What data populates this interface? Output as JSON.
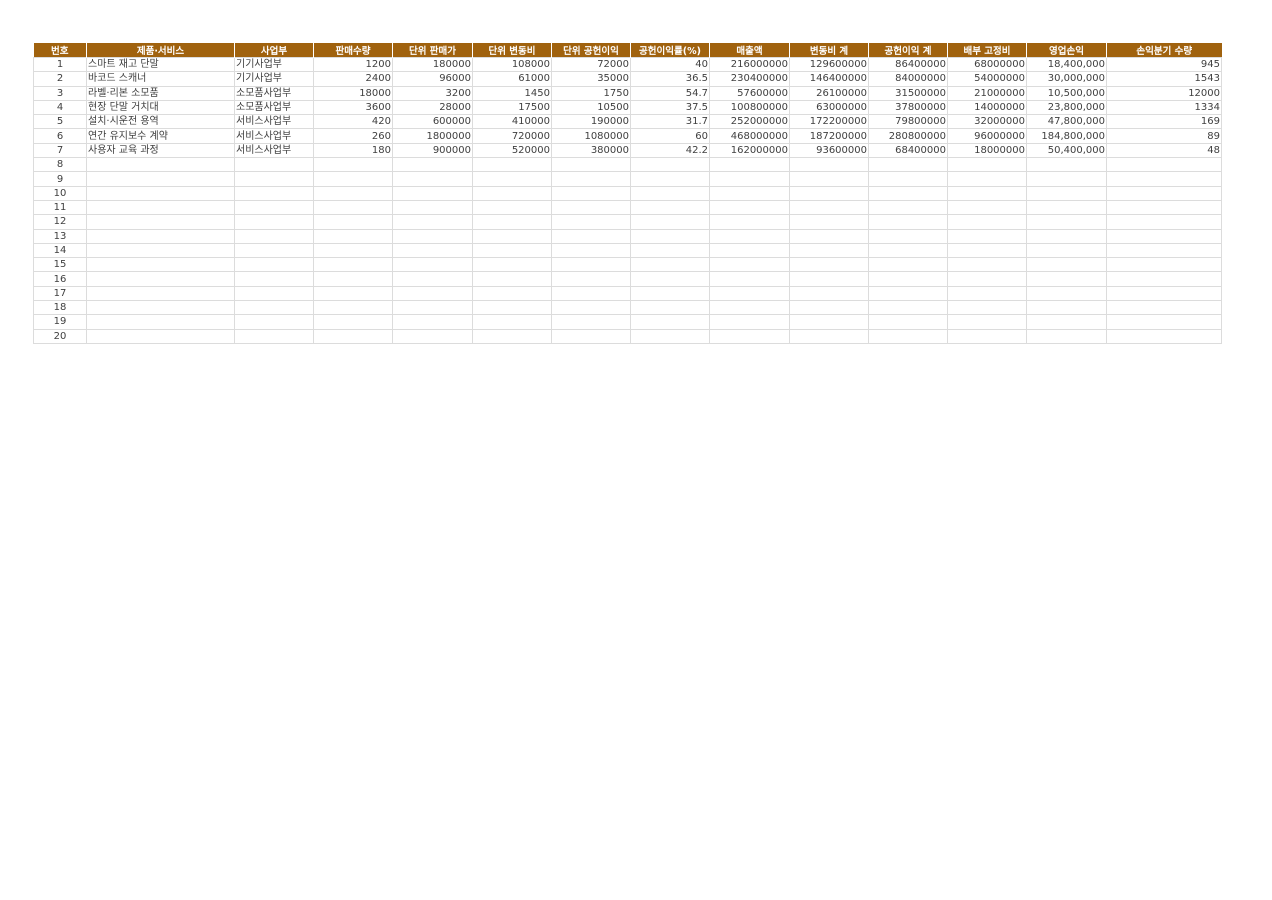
{
  "headers": [
    "번호",
    "제품·서비스",
    "사업부",
    "판매수량",
    "단위 판매가",
    "단위 변동비",
    "단위 공헌이익",
    "공헌이익률(%)",
    "매출액",
    "변동비 계",
    "공헌이익 계",
    "배부 고정비",
    "영업손익",
    "손익분기 수량"
  ],
  "rows": [
    [
      "1",
      "스마트 재고 단말",
      "기기사업부",
      "1200",
      "180000",
      "108000",
      "72000",
      "40",
      "216000000",
      "129600000",
      "86400000",
      "68000000",
      "18,400,000",
      "945"
    ],
    [
      "2",
      "바코드 스캐너",
      "기기사업부",
      "2400",
      "96000",
      "61000",
      "35000",
      "36.5",
      "230400000",
      "146400000",
      "84000000",
      "54000000",
      "30,000,000",
      "1543"
    ],
    [
      "3",
      "라벨·리본 소모품",
      "소모품사업부",
      "18000",
      "3200",
      "1450",
      "1750",
      "54.7",
      "57600000",
      "26100000",
      "31500000",
      "21000000",
      "10,500,000",
      "12000"
    ],
    [
      "4",
      "현장 단말 거치대",
      "소모품사업부",
      "3600",
      "28000",
      "17500",
      "10500",
      "37.5",
      "100800000",
      "63000000",
      "37800000",
      "14000000",
      "23,800,000",
      "1334"
    ],
    [
      "5",
      "설치·시운전 용역",
      "서비스사업부",
      "420",
      "600000",
      "410000",
      "190000",
      "31.7",
      "252000000",
      "172200000",
      "79800000",
      "32000000",
      "47,800,000",
      "169"
    ],
    [
      "6",
      "연간 유지보수 계약",
      "서비스사업부",
      "260",
      "1800000",
      "720000",
      "1080000",
      "60",
      "468000000",
      "187200000",
      "280800000",
      "96000000",
      "184,800,000",
      "89"
    ],
    [
      "7",
      "사용자 교육 과정",
      "서비스사업부",
      "180",
      "900000",
      "520000",
      "380000",
      "42.2",
      "162000000",
      "93600000",
      "68400000",
      "18000000",
      "50,400,000",
      "48"
    ],
    [
      "8",
      "",
      "",
      "",
      "",
      "",
      "",
      "",
      "",
      "",
      "",
      "",
      "",
      ""
    ],
    [
      "9",
      "",
      "",
      "",
      "",
      "",
      "",
      "",
      "",
      "",
      "",
      "",
      "",
      ""
    ],
    [
      "10",
      "",
      "",
      "",
      "",
      "",
      "",
      "",
      "",
      "",
      "",
      "",
      "",
      ""
    ],
    [
      "11",
      "",
      "",
      "",
      "",
      "",
      "",
      "",
      "",
      "",
      "",
      "",
      "",
      ""
    ],
    [
      "12",
      "",
      "",
      "",
      "",
      "",
      "",
      "",
      "",
      "",
      "",
      "",
      "",
      ""
    ],
    [
      "13",
      "",
      "",
      "",
      "",
      "",
      "",
      "",
      "",
      "",
      "",
      "",
      "",
      ""
    ],
    [
      "14",
      "",
      "",
      "",
      "",
      "",
      "",
      "",
      "",
      "",
      "",
      "",
      "",
      ""
    ],
    [
      "15",
      "",
      "",
      "",
      "",
      "",
      "",
      "",
      "",
      "",
      "",
      "",
      "",
      ""
    ],
    [
      "16",
      "",
      "",
      "",
      "",
      "",
      "",
      "",
      "",
      "",
      "",
      "",
      "",
      ""
    ],
    [
      "17",
      "",
      "",
      "",
      "",
      "",
      "",
      "",
      "",
      "",
      "",
      "",
      "",
      ""
    ],
    [
      "18",
      "",
      "",
      "",
      "",
      "",
      "",
      "",
      "",
      "",
      "",
      "",
      "",
      ""
    ],
    [
      "19",
      "",
      "",
      "",
      "",
      "",
      "",
      "",
      "",
      "",
      "",
      "",
      "",
      ""
    ],
    [
      "20",
      "",
      "",
      "",
      "",
      "",
      "",
      "",
      "",
      "",
      "",
      "",
      "",
      ""
    ]
  ],
  "colors": {
    "header_bg": "#a0620e",
    "header_text": "#ffffff",
    "grid": "#dcdcdc",
    "cell_text": "#404040"
  }
}
